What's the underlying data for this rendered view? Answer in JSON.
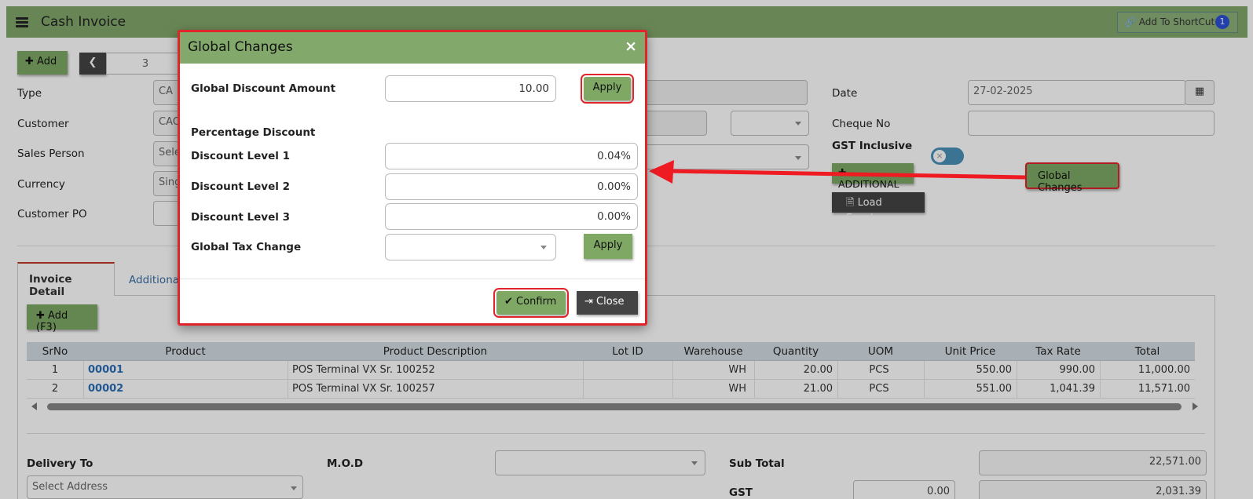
{
  "header": {
    "title": "Cash Invoice",
    "shortcut_label": "Add To ShortCut",
    "shortcut_badge": "1"
  },
  "toolbar": {
    "add_label": "Add",
    "record_number": "3"
  },
  "form": {
    "type_label": "Type",
    "type_value": "CA",
    "customer_label": "Customer",
    "customer_value": "CAC",
    "sales_person_label": "Sales Person",
    "sales_person_placeholder": "Sele",
    "currency_label": "Currency",
    "currency_value": "Sing",
    "customer_po_label": "Customer PO",
    "date_label": "Date",
    "date_value": "27-02-2025",
    "cheque_label": "Cheque No",
    "gst_label": "GST Inclusive",
    "additional_label": "ADDITIONAL",
    "load_excel_label": "Load Excel",
    "global_changes_label": "Global Changes"
  },
  "tabs": {
    "invoice_detail": "Invoice Detail",
    "additional": "Additiona"
  },
  "grid": {
    "add_label": "Add (F3)",
    "columns": [
      "SrNo",
      "Product",
      "Product Description",
      "Lot ID",
      "Warehouse",
      "Quantity",
      "UOM",
      "Unit Price",
      "Tax Rate",
      "Total"
    ],
    "rows": [
      {
        "srno": "1",
        "product": "00001",
        "description": "POS Terminal VX Sr. 100252",
        "lot": "",
        "warehouse": "WH",
        "quantity": "20.00",
        "uom": "PCS",
        "unit_price": "550.00",
        "tax_rate": "990.00",
        "total": "11,000.00"
      },
      {
        "srno": "2",
        "product": "00002",
        "description": "POS Terminal VX Sr. 100257",
        "lot": "",
        "warehouse": "WH",
        "quantity": "21.00",
        "uom": "PCS",
        "unit_price": "551.00",
        "tax_rate": "1,041.39",
        "total": "11,571.00"
      }
    ]
  },
  "footer": {
    "delivery_label": "Delivery To",
    "delivery_placeholder": "Select Address",
    "mod_label": "M.O.D",
    "subtotal_label": "Sub Total",
    "subtotal_value": "22,571.00",
    "gst_value_partial": "0.00",
    "gst_label_partial": "GST",
    "gst_amount_partial": "2,031.39"
  },
  "modal": {
    "title": "Global Changes",
    "close_symbol": "×",
    "global_discount_label": "Global Discount Amount",
    "global_discount_value": "10.00",
    "apply_label": "Apply",
    "percentage_heading": "Percentage Discount",
    "level1_label": "Discount Level 1",
    "level1_value": "0.04%",
    "level2_label": "Discount Level 2",
    "level2_value": "0.00%",
    "level3_label": "Discount Level 3",
    "level3_value": "0.00%",
    "tax_change_label": "Global Tax Change",
    "tax_apply_label": "Apply",
    "confirm_label": "Confirm",
    "close_label": "Close"
  },
  "colors": {
    "accent_green": "#83a86b",
    "highlight_red": "#e0252a",
    "dark_button": "#444444"
  }
}
